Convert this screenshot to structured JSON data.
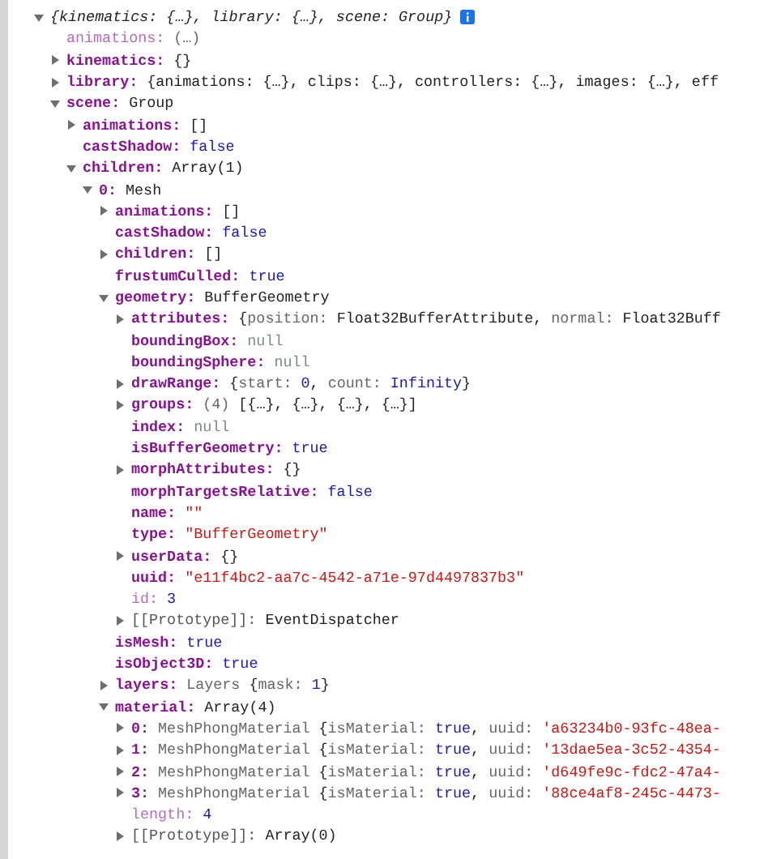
{
  "root": {
    "expanded": true,
    "preview": "{kinematics: {…}, library: {…}, scene: Group}",
    "children": [
      {
        "key": "animations:",
        "kind": "getter",
        "value": [
          {
            "kind": "dim",
            "text": "(…)"
          }
        ]
      },
      {
        "key": "kinematics:",
        "kind": "property",
        "expanded": false,
        "value": [
          {
            "kind": "plain",
            "text": "{}"
          }
        ]
      },
      {
        "key": "library:",
        "kind": "property",
        "expanded": false,
        "value": [
          {
            "kind": "plain",
            "text": "{animations: {…}, clips: {…}, controllers: {…}, images: {…}, eff"
          }
        ]
      },
      {
        "key": "scene:",
        "kind": "property",
        "expanded": true,
        "value": [
          {
            "kind": "plain",
            "text": "Group"
          }
        ],
        "children": [
          {
            "key": "animations:",
            "kind": "property",
            "expanded": false,
            "value": [
              {
                "kind": "plain",
                "text": "[]"
              }
            ]
          },
          {
            "key": "castShadow:",
            "kind": "property",
            "value": [
              {
                "kind": "keyword",
                "text": "false"
              }
            ]
          },
          {
            "key": "children:",
            "kind": "property",
            "expanded": true,
            "value": [
              {
                "kind": "plain",
                "text": "Array(1)"
              }
            ],
            "children": [
              {
                "key": "0:",
                "kind": "property",
                "expanded": true,
                "value": [
                  {
                    "kind": "plain",
                    "text": "Mesh"
                  }
                ],
                "children": [
                  {
                    "key": "animations:",
                    "kind": "property",
                    "expanded": false,
                    "value": [
                      {
                        "kind": "plain",
                        "text": "[]"
                      }
                    ]
                  },
                  {
                    "key": "castShadow:",
                    "kind": "property",
                    "value": [
                      {
                        "kind": "keyword",
                        "text": "false"
                      }
                    ]
                  },
                  {
                    "key": "children:",
                    "kind": "property",
                    "expanded": false,
                    "value": [
                      {
                        "kind": "plain",
                        "text": "[]"
                      }
                    ]
                  },
                  {
                    "key": "frustumCulled:",
                    "kind": "property",
                    "value": [
                      {
                        "kind": "keyword",
                        "text": "true"
                      }
                    ]
                  },
                  {
                    "key": "geometry:",
                    "kind": "property",
                    "expanded": true,
                    "value": [
                      {
                        "kind": "plain",
                        "text": "BufferGeometry"
                      }
                    ],
                    "children": [
                      {
                        "key": "attributes:",
                        "kind": "property",
                        "expanded": false,
                        "value": [
                          {
                            "kind": "plain",
                            "text": "{"
                          },
                          {
                            "kind": "dim",
                            "text": "position: "
                          },
                          {
                            "kind": "plain",
                            "text": "Float32BufferAttribute, "
                          },
                          {
                            "kind": "dim",
                            "text": "normal: "
                          },
                          {
                            "kind": "plain",
                            "text": "Float32Buff"
                          }
                        ]
                      },
                      {
                        "key": "boundingBox:",
                        "kind": "property",
                        "value": [
                          {
                            "kind": "null",
                            "text": "null"
                          }
                        ]
                      },
                      {
                        "key": "boundingSphere:",
                        "kind": "property",
                        "value": [
                          {
                            "kind": "null",
                            "text": "null"
                          }
                        ]
                      },
                      {
                        "key": "drawRange:",
                        "kind": "property",
                        "expanded": false,
                        "value": [
                          {
                            "kind": "plain",
                            "text": "{"
                          },
                          {
                            "kind": "dim",
                            "text": "start: "
                          },
                          {
                            "kind": "keyword",
                            "text": "0"
                          },
                          {
                            "kind": "plain",
                            "text": ", "
                          },
                          {
                            "kind": "dim",
                            "text": "count: "
                          },
                          {
                            "kind": "keyword",
                            "text": "Infinity"
                          },
                          {
                            "kind": "plain",
                            "text": "}"
                          }
                        ]
                      },
                      {
                        "key": "groups:",
                        "kind": "property",
                        "expanded": false,
                        "value": [
                          {
                            "kind": "dim",
                            "text": "(4) "
                          },
                          {
                            "kind": "plain",
                            "text": "[{…}, {…}, {…}, {…}]"
                          }
                        ]
                      },
                      {
                        "key": "index:",
                        "kind": "property",
                        "value": [
                          {
                            "kind": "null",
                            "text": "null"
                          }
                        ]
                      },
                      {
                        "key": "isBufferGeometry:",
                        "kind": "property",
                        "value": [
                          {
                            "kind": "keyword",
                            "text": "true"
                          }
                        ]
                      },
                      {
                        "key": "morphAttributes:",
                        "kind": "property",
                        "expanded": false,
                        "value": [
                          {
                            "kind": "plain",
                            "text": "{}"
                          }
                        ]
                      },
                      {
                        "key": "morphTargetsRelative:",
                        "kind": "property",
                        "value": [
                          {
                            "kind": "keyword",
                            "text": "false"
                          }
                        ]
                      },
                      {
                        "key": "name:",
                        "kind": "property",
                        "value": [
                          {
                            "kind": "string",
                            "text": "\"\""
                          }
                        ]
                      },
                      {
                        "key": "type:",
                        "kind": "property",
                        "value": [
                          {
                            "kind": "string",
                            "text": "\"BufferGeometry\""
                          }
                        ]
                      },
                      {
                        "key": "userData:",
                        "kind": "property",
                        "expanded": false,
                        "value": [
                          {
                            "kind": "plain",
                            "text": "{}"
                          }
                        ]
                      },
                      {
                        "key": "uuid:",
                        "kind": "property",
                        "value": [
                          {
                            "kind": "string",
                            "text": "\"e11f4bc2-aa7c-4542-a71e-97d4497837b3\""
                          }
                        ]
                      },
                      {
                        "key": "id:",
                        "kind": "getter",
                        "value": [
                          {
                            "kind": "keyword",
                            "text": "3"
                          }
                        ]
                      },
                      {
                        "key": "[[Prototype]]:",
                        "kind": "internal",
                        "expanded": false,
                        "value": [
                          {
                            "kind": "plain",
                            "text": "EventDispatcher"
                          }
                        ]
                      }
                    ]
                  },
                  {
                    "key": "isMesh:",
                    "kind": "property",
                    "value": [
                      {
                        "kind": "keyword",
                        "text": "true"
                      }
                    ]
                  },
                  {
                    "key": "isObject3D:",
                    "kind": "property",
                    "value": [
                      {
                        "kind": "keyword",
                        "text": "true"
                      }
                    ]
                  },
                  {
                    "key": "layers:",
                    "kind": "property",
                    "expanded": false,
                    "value": [
                      {
                        "kind": "dim",
                        "text": "Layers "
                      },
                      {
                        "kind": "plain",
                        "text": "{"
                      },
                      {
                        "kind": "dim",
                        "text": "mask: "
                      },
                      {
                        "kind": "keyword",
                        "text": "1"
                      },
                      {
                        "kind": "plain",
                        "text": "}"
                      }
                    ]
                  },
                  {
                    "key": "material:",
                    "kind": "property",
                    "expanded": true,
                    "value": [
                      {
                        "kind": "plain",
                        "text": "Array(4)"
                      }
                    ],
                    "children": [
                      {
                        "key": "0:",
                        "kind": "property",
                        "expanded": false,
                        "value": [
                          {
                            "kind": "dim",
                            "text": "MeshPhongMaterial "
                          },
                          {
                            "kind": "plain",
                            "text": "{"
                          },
                          {
                            "kind": "dim",
                            "text": "isMaterial: "
                          },
                          {
                            "kind": "keyword",
                            "text": "true"
                          },
                          {
                            "kind": "plain",
                            "text": ", "
                          },
                          {
                            "kind": "dim",
                            "text": "uuid: "
                          },
                          {
                            "kind": "string",
                            "text": "'a63234b0-93fc-48ea-"
                          }
                        ]
                      },
                      {
                        "key": "1:",
                        "kind": "property",
                        "expanded": false,
                        "value": [
                          {
                            "kind": "dim",
                            "text": "MeshPhongMaterial "
                          },
                          {
                            "kind": "plain",
                            "text": "{"
                          },
                          {
                            "kind": "dim",
                            "text": "isMaterial: "
                          },
                          {
                            "kind": "keyword",
                            "text": "true"
                          },
                          {
                            "kind": "plain",
                            "text": ", "
                          },
                          {
                            "kind": "dim",
                            "text": "uuid: "
                          },
                          {
                            "kind": "string",
                            "text": "'13dae5ea-3c52-4354-"
                          }
                        ]
                      },
                      {
                        "key": "2:",
                        "kind": "property",
                        "expanded": false,
                        "value": [
                          {
                            "kind": "dim",
                            "text": "MeshPhongMaterial "
                          },
                          {
                            "kind": "plain",
                            "text": "{"
                          },
                          {
                            "kind": "dim",
                            "text": "isMaterial: "
                          },
                          {
                            "kind": "keyword",
                            "text": "true"
                          },
                          {
                            "kind": "plain",
                            "text": ", "
                          },
                          {
                            "kind": "dim",
                            "text": "uuid: "
                          },
                          {
                            "kind": "string",
                            "text": "'d649fe9c-fdc2-47a4-"
                          }
                        ]
                      },
                      {
                        "key": "3:",
                        "kind": "property",
                        "expanded": false,
                        "value": [
                          {
                            "kind": "dim",
                            "text": "MeshPhongMaterial "
                          },
                          {
                            "kind": "plain",
                            "text": "{"
                          },
                          {
                            "kind": "dim",
                            "text": "isMaterial: "
                          },
                          {
                            "kind": "keyword",
                            "text": "true"
                          },
                          {
                            "kind": "plain",
                            "text": ", "
                          },
                          {
                            "kind": "dim",
                            "text": "uuid: "
                          },
                          {
                            "kind": "string",
                            "text": "'88ce4af8-245c-4473-"
                          }
                        ]
                      },
                      {
                        "key": "length:",
                        "kind": "getter",
                        "value": [
                          {
                            "kind": "keyword",
                            "text": "4"
                          }
                        ]
                      },
                      {
                        "key": "[[Prototype]]:",
                        "kind": "internal",
                        "expanded": false,
                        "value": [
                          {
                            "kind": "plain",
                            "text": "Array(0)"
                          }
                        ]
                      }
                    ]
                  }
                ]
              }
            ]
          }
        ]
      }
    ]
  }
}
